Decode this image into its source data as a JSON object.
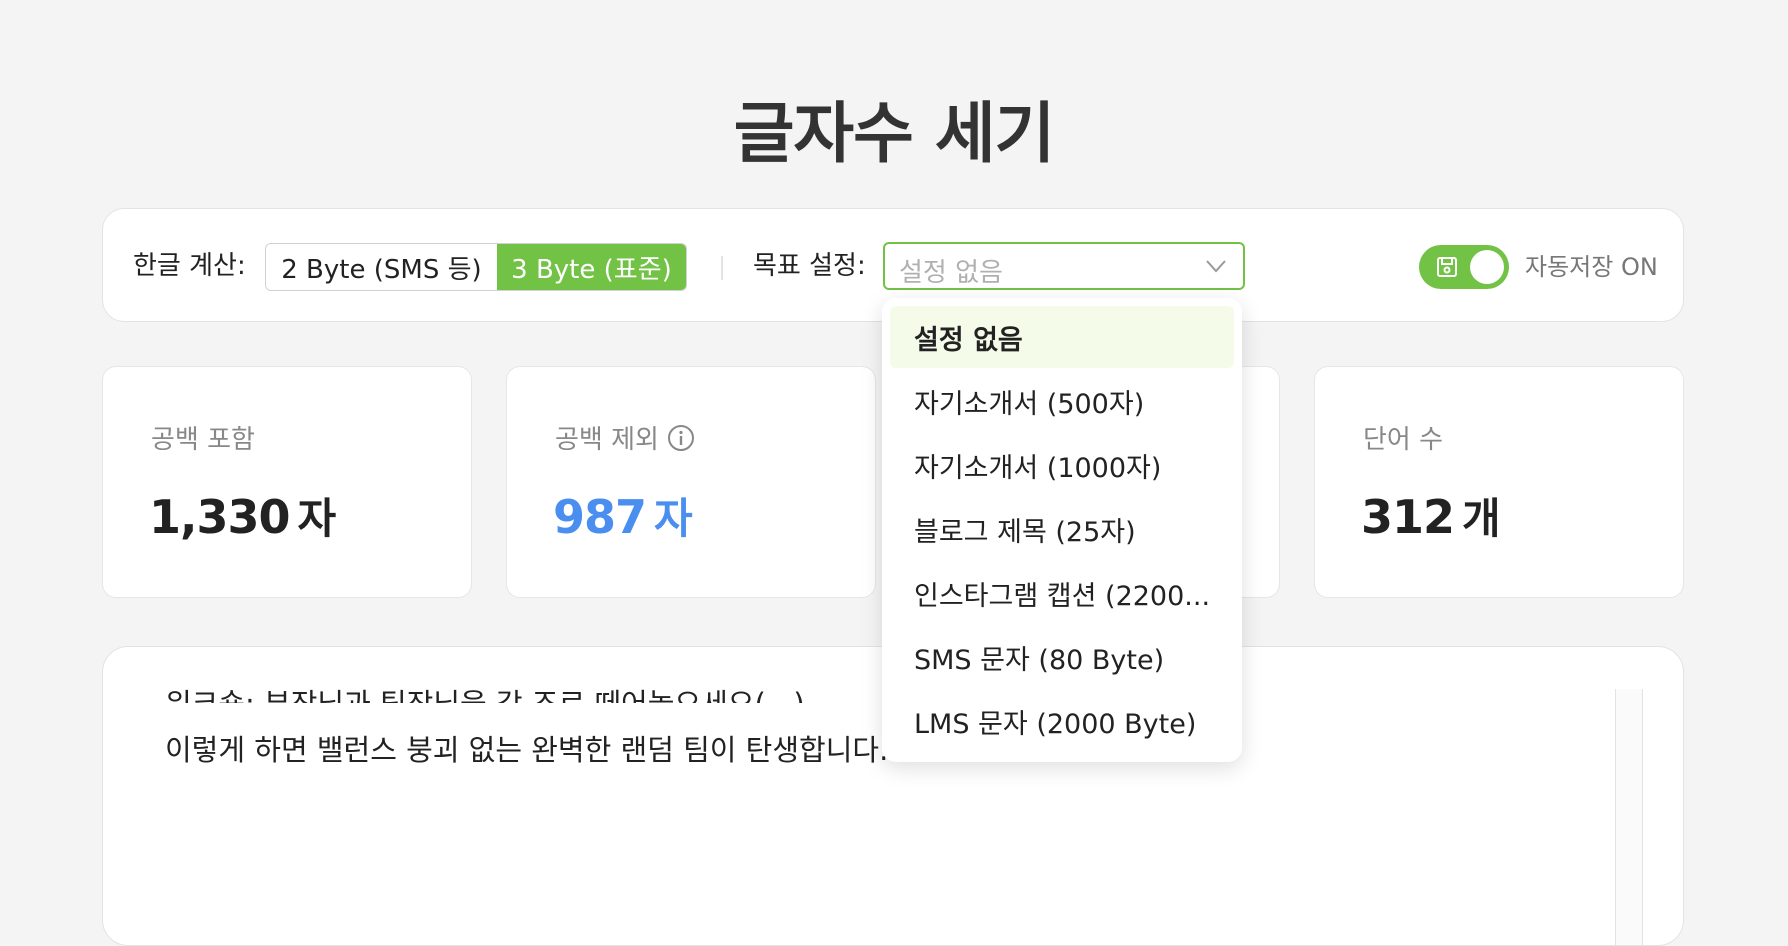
{
  "title": "글자수 세기",
  "toolbar": {
    "hangul_label": "한글 계산:",
    "byte_options": [
      "2 Byte (SMS 등)",
      "3 Byte (표준)"
    ],
    "byte_selected": "3 Byte (표준)",
    "goal_label": "목표 설정:",
    "goal_value": "설정 없음",
    "autosave_on": true,
    "autosave_label": "자동저장 ON"
  },
  "cards": [
    {
      "label": "공백 포함",
      "value": "1,330",
      "unit": "자"
    },
    {
      "label": "공백 제외",
      "value": "987",
      "unit": "자"
    },
    {
      "label": "단어 수",
      "value": "312",
      "unit": "개"
    }
  ],
  "editor": {
    "line1": "워크숍: 부장님과 팀장님을 각 조로 떼어놓으세요(...)",
    "line2": "이렇게 하면 밸런스 붕괴 없는 완벽한 랜덤 팀이 탄생합니다."
  },
  "dropdown": {
    "items": [
      "설정 없음",
      "자기소개서 (500자)",
      "자기소개서 (1000자)",
      "블로그 제목 (25자)",
      "인스타그램 캡션 (2200...",
      "SMS 문자 (80 Byte)",
      "LMS 문자 (2000 Byte)"
    ],
    "selected": "설정 없음"
  },
  "colors": {
    "accent": "#72c246",
    "highlight_value": "#4a8ef0",
    "selected_item_bg": "#f4fbe9"
  }
}
